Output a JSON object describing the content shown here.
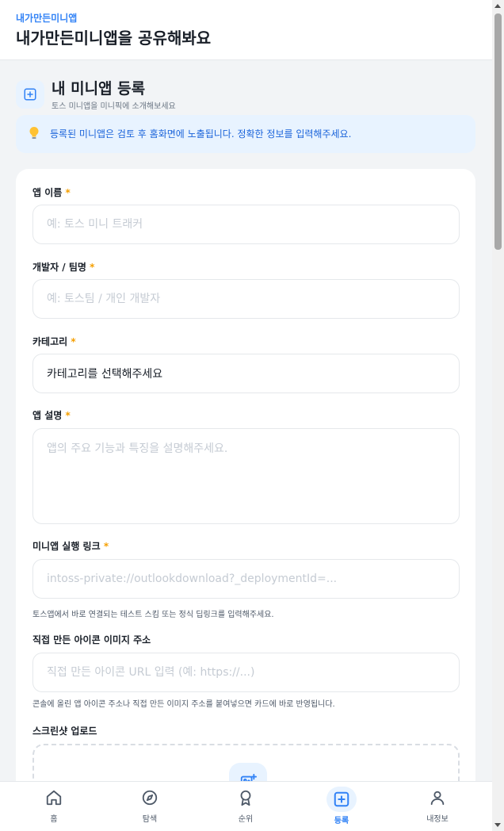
{
  "header": {
    "app_name": "내가만든미니앱",
    "title": "내가만든미니앱을 공유해봐요"
  },
  "section": {
    "icon": "plus-square-icon",
    "title": "내 미니앱 등록",
    "description": "토스 미니앱을 미니픽에 소개해보세요"
  },
  "notice": {
    "icon": "lightbulb-icon",
    "text": "등록된 미니앱은 검토 후 홈화면에 노출됩니다. 정확한 정보를 입력해주세요."
  },
  "form": {
    "required_mark": "*",
    "app_name": {
      "label": "앱 이름",
      "placeholder": "예: 토스 미니 트래커",
      "value": ""
    },
    "developer": {
      "label": "개발자 / 팀명",
      "placeholder": "예: 토스팀 / 개인 개발자",
      "value": ""
    },
    "category": {
      "label": "카테고리",
      "selected": "카테고리를 선택해주세요"
    },
    "description": {
      "label": "앱 설명",
      "placeholder": "앱의 주요 기능과 특징을 설명해주세요.",
      "value": ""
    },
    "link": {
      "label": "미니앱 실행 링크",
      "placeholder": "intoss-private://outlookdownload?_deploymentId=...",
      "value": "",
      "helper": "토스앱에서 바로 연결되는 테스트 스킴 또는 정식 딥링크를 입력해주세요."
    },
    "icon_url": {
      "label": "직접 만든 아이콘 이미지 주소",
      "placeholder": "직접 만든 아이콘 URL 입력 (예: https://...)",
      "value": "",
      "helper": "콘솔에 올린 앱 아이콘 주소나 직접 만든 이미지 주소를 붙여넣으면 카드에 바로 반영됩니다."
    },
    "screenshot": {
      "label": "스크린샷 업로드",
      "icon": "image-add-icon"
    }
  },
  "tabbar": {
    "active": "register",
    "items": [
      {
        "id": "home",
        "label": "홈",
        "icon": "home-icon"
      },
      {
        "id": "explore",
        "label": "탐색",
        "icon": "compass-icon"
      },
      {
        "id": "ranking",
        "label": "순위",
        "icon": "award-icon"
      },
      {
        "id": "register",
        "label": "등록",
        "icon": "plus-square-icon"
      },
      {
        "id": "profile",
        "label": "내정보",
        "icon": "user-icon"
      }
    ]
  },
  "colors": {
    "accent": "#3182f6",
    "accent_light": "#e8f3ff",
    "required": "#f59f00",
    "text": "#191f28",
    "placeholder": "#c5cbd3"
  }
}
